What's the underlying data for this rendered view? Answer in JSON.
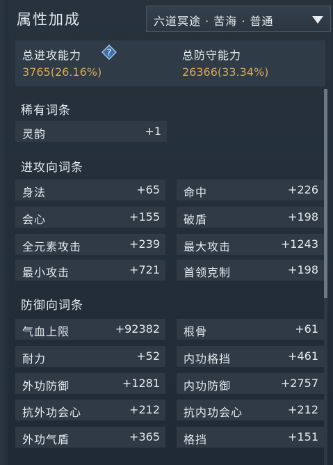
{
  "title": "属性加成",
  "dropdown": {
    "label": "六道冥途 · 苦海 · 普通"
  },
  "summary": {
    "attack_label": "总进攻能力",
    "attack_value": "3765(26.16%)",
    "defense_label": "总防守能力",
    "defense_value": "26366(33.34%)"
  },
  "sections": [
    {
      "title": "稀有词条",
      "rows": [
        [
          "灵韵",
          "+1"
        ]
      ]
    },
    {
      "title": "进攻向词条",
      "rows": [
        [
          "身法",
          "+65"
        ],
        [
          "命中",
          "+226"
        ],
        [
          "会心",
          "+155"
        ],
        [
          "破盾",
          "+198"
        ],
        [
          "全元素攻击",
          "+239"
        ],
        [
          "最大攻击",
          "+1243"
        ],
        [
          "最小攻击",
          "+721"
        ],
        [
          "首领克制",
          "+198"
        ]
      ]
    },
    {
      "title": "防御向词条",
      "rows": [
        [
          "气血上限",
          "+92382"
        ],
        [
          "根骨",
          "+61"
        ],
        [
          "耐力",
          "+52"
        ],
        [
          "内功格挡",
          "+461"
        ],
        [
          "外功防御",
          "+1281"
        ],
        [
          "内功防御",
          "+2757"
        ],
        [
          "抗外功会心",
          "+212"
        ],
        [
          "抗内功会心",
          "+212"
        ],
        [
          "外功气盾",
          "+365"
        ],
        [
          "格挡",
          "+151"
        ]
      ]
    }
  ],
  "colors": {
    "accent_value": "#d7a85a",
    "row_bg": "#2f3a45",
    "panel_bg": "#27323d"
  },
  "icons": {
    "help": "question-diamond-icon",
    "dropdown": "triangle-down-icon"
  }
}
